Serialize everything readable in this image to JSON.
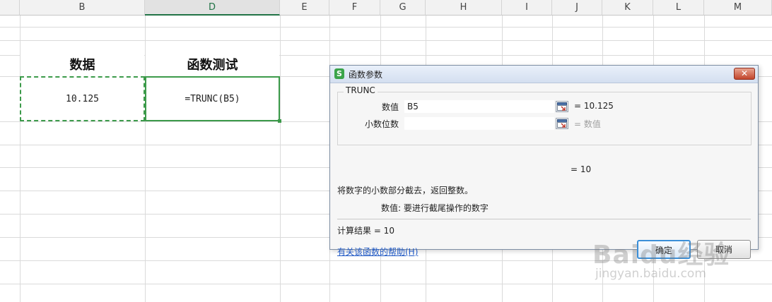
{
  "columns": [
    {
      "id": "B",
      "label": "B"
    },
    {
      "id": "D",
      "label": "D"
    },
    {
      "id": "E",
      "label": "E"
    },
    {
      "id": "F",
      "label": "F"
    },
    {
      "id": "G",
      "label": "G"
    },
    {
      "id": "H",
      "label": "H"
    },
    {
      "id": "I",
      "label": "I"
    },
    {
      "id": "J",
      "label": "J"
    },
    {
      "id": "K",
      "label": "K"
    },
    {
      "id": "L",
      "label": "L"
    },
    {
      "id": "M",
      "label": "M"
    }
  ],
  "active_column": "D",
  "cells": {
    "b_header": "数据",
    "d_header": "函数测试",
    "b5_value": "10.125",
    "d5_formula": "=TRUNC(B5)"
  },
  "dialog": {
    "icon_letter": "S",
    "title": "函数参数",
    "close_label": "✕",
    "function_name": "TRUNC",
    "args": [
      {
        "label": "数值",
        "value": "B5",
        "result": "= 10.125"
      },
      {
        "label": "小数位数",
        "value": "",
        "result": "= 数值"
      }
    ],
    "overall_result": "= 10",
    "description": "将数字的小数部分截去，返回整数。",
    "param_help": "数值:  要进行截尾操作的数字",
    "calc_result": "计算结果 =  10",
    "help_link": "有关该函数的帮助(H)",
    "ok_label": "确定",
    "cancel_label": "取消"
  },
  "watermark": {
    "logo": "Baidu经验",
    "url": "jingyan.baidu.com"
  },
  "colors": {
    "selection_green": "#3c9a4a",
    "link_blue": "#1f58c4",
    "accent_blue": "#3b8fd8"
  }
}
